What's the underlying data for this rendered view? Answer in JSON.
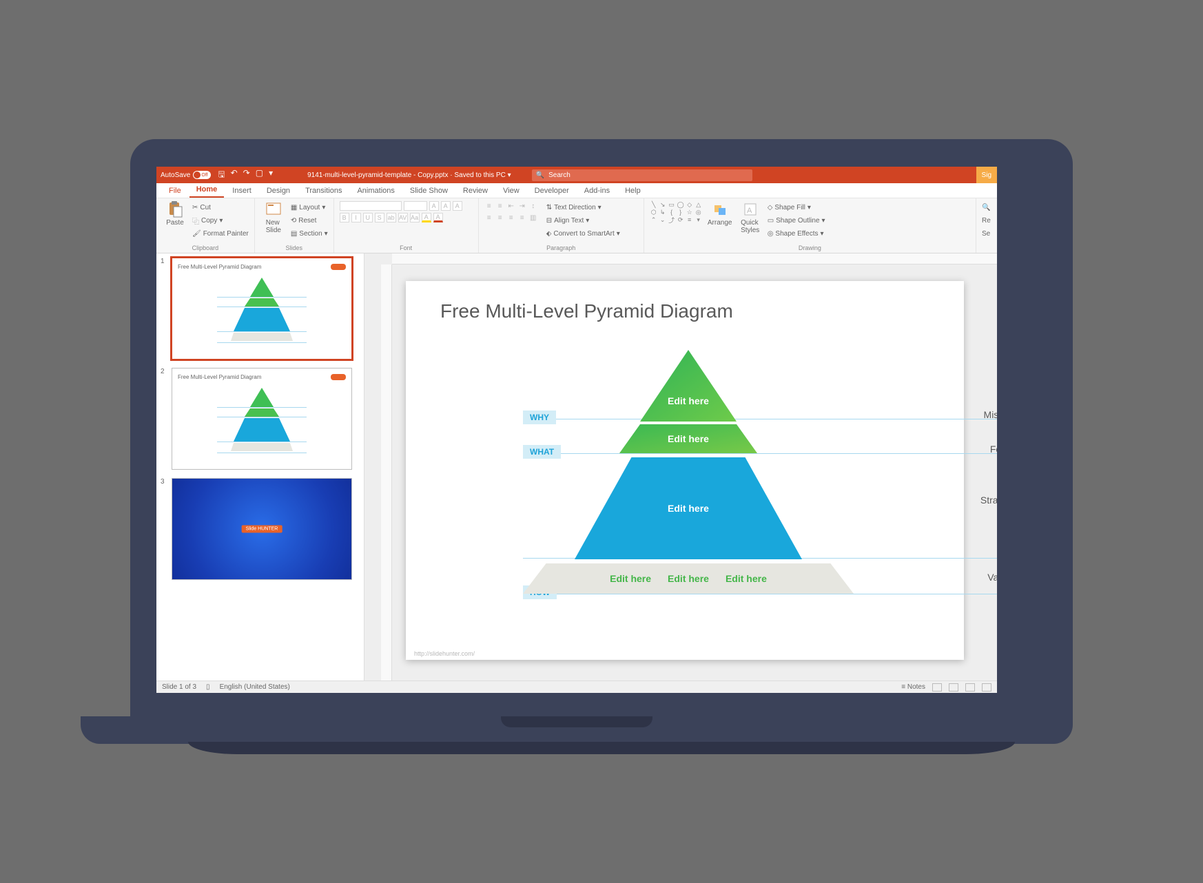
{
  "titlebar": {
    "autosave_label": "AutoSave",
    "autosave_state": "Off",
    "filename": "9141-multi-level-pyramid-template - Copy.pptx",
    "save_state": "Saved to this PC",
    "search_placeholder": "Search",
    "signin": "Sig"
  },
  "tabs": [
    "File",
    "Home",
    "Insert",
    "Design",
    "Transitions",
    "Animations",
    "Slide Show",
    "Review",
    "View",
    "Developer",
    "Add-ins",
    "Help"
  ],
  "active_tab": "Home",
  "ribbon": {
    "clipboard": {
      "label": "Clipboard",
      "paste": "Paste",
      "cut": "Cut",
      "copy": "Copy",
      "format_painter": "Format Painter"
    },
    "slides": {
      "label": "Slides",
      "new_slide": "New\nSlide",
      "layout": "Layout",
      "reset": "Reset",
      "section": "Section"
    },
    "font": {
      "label": "Font"
    },
    "paragraph": {
      "label": "Paragraph",
      "text_direction": "Text Direction",
      "align_text": "Align Text",
      "convert_smartart": "Convert to SmartArt"
    },
    "drawing": {
      "label": "Drawing",
      "arrange": "Arrange",
      "quick_styles": "Quick\nStyles",
      "shape_fill": "Shape Fill",
      "shape_outline": "Shape Outline",
      "shape_effects": "Shape Effects"
    },
    "editing_extra": {
      "replace": "Re",
      "select": "Se"
    }
  },
  "thumbnails": [
    {
      "num": "1",
      "title": "Free Multi-Level Pyramid Diagram",
      "selected": true,
      "type": "pyramid"
    },
    {
      "num": "2",
      "title": "Free Multi-Level Pyramid Diagram",
      "selected": false,
      "type": "pyramid"
    },
    {
      "num": "3",
      "title": "",
      "selected": false,
      "type": "brand",
      "brand": "Slide HUNTER"
    }
  ],
  "slide": {
    "title": "Free Multi-Level Pyramid Diagram",
    "rows": [
      {
        "left": "WHY",
        "center": "Edit here",
        "right": "Mission"
      },
      {
        "left": "WHAT",
        "center": "Edit here",
        "right": "Focus"
      },
      {
        "left": "",
        "center": "Edit here",
        "right": "Strategy"
      },
      {
        "left": "HOW",
        "center": [
          "Edit here",
          "Edit here",
          "Edit here"
        ],
        "right": "Values"
      }
    ],
    "footer": "http://slidehunter.com/"
  },
  "chart_data": {
    "type": "pyramid",
    "title": "Free Multi-Level Pyramid Diagram",
    "levels": [
      {
        "order": 1,
        "question": "WHY",
        "content": "Edit here",
        "label": "Mission",
        "color": "#3fbf55"
      },
      {
        "order": 2,
        "question": "WHAT",
        "content": "Edit here",
        "label": "Focus",
        "color": "#49c04f"
      },
      {
        "order": 3,
        "question": "",
        "content": "Edit here",
        "label": "Strategy",
        "color": "#19a7db"
      },
      {
        "order": 4,
        "question": "HOW",
        "content": [
          "Edit here",
          "Edit here",
          "Edit here"
        ],
        "label": "Values",
        "color": "#e6e6e0"
      }
    ]
  },
  "status": {
    "slide_counter": "Slide 1 of 3",
    "language": "English (United States)",
    "notes": "Notes"
  }
}
